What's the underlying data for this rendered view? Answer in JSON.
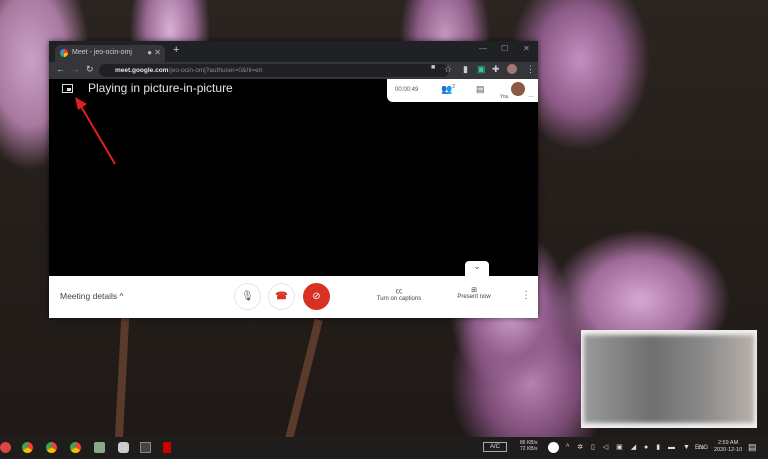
{
  "browser": {
    "tab_title": "Meet - jeo-ocin-omj",
    "new_tab": "+",
    "url_host": "meet.google.com",
    "url_path": "/jeo-ocin-omj?authuser=0&hl=en"
  },
  "meet": {
    "pip_message": "Playing in picture-in-picture",
    "timer": "00:00:49",
    "participants_count": "2",
    "self_label": "You",
    "meeting_details": "Meeting details",
    "captions_label": "Turn on captions",
    "present_label": "Present now"
  },
  "colors": {
    "end_call": "#d93025",
    "video_off": "#d93025"
  },
  "taskbar": {
    "ac_label": "A/C",
    "net_down": "86 KB/s",
    "net_up": "72 KB/s",
    "lang": "ENG",
    "time": "2:59 AM",
    "date": "2020-12-10"
  }
}
